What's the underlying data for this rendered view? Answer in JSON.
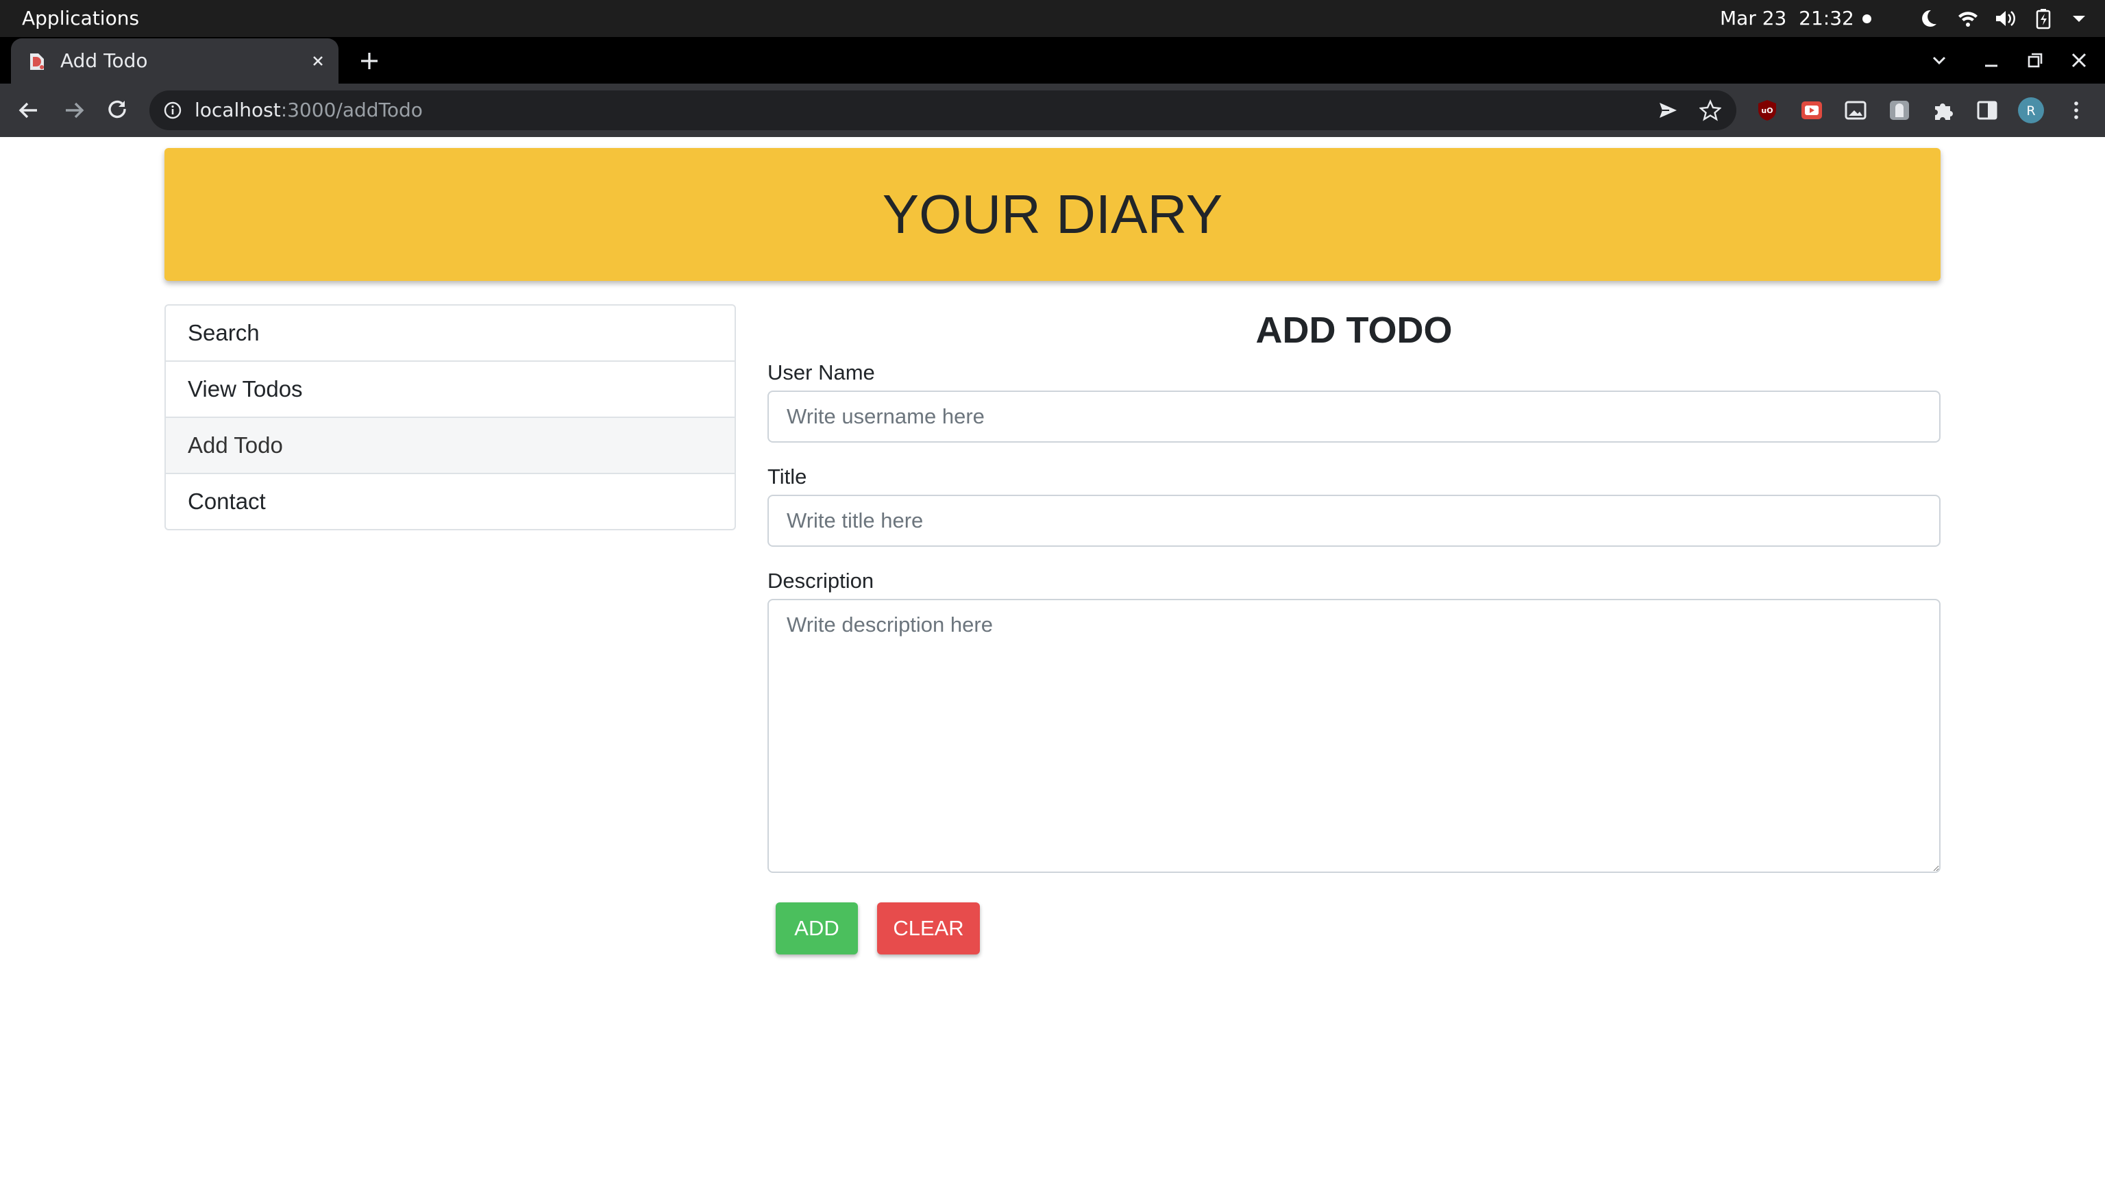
{
  "system_bar": {
    "applications_label": "Applications",
    "date": "Mar 23",
    "time": "21:32",
    "icons": [
      "night-light-icon",
      "wifi-icon",
      "volume-icon",
      "battery-icon",
      "system-menu-chevron-icon"
    ]
  },
  "browser": {
    "tab": {
      "title": "Add Todo"
    },
    "address": {
      "host": "localhost",
      "path": ":3000/addTodo"
    },
    "avatar_letter": "R",
    "extension_icons": [
      "ublock-icon",
      "youtube-ext-icon",
      "picture-in-picture-icon",
      "dark-reader-icon",
      "extensions-puzzle-icon",
      "side-panel-icon"
    ]
  },
  "page": {
    "banner_title": "YOUR DIARY",
    "sidebar": {
      "items": [
        {
          "label": "Search"
        },
        {
          "label": "View Todos"
        },
        {
          "label": "Add Todo"
        },
        {
          "label": "Contact"
        }
      ],
      "active_item": "Add Todo"
    },
    "form": {
      "title": "ADD TODO",
      "username": {
        "label": "User Name",
        "value": "",
        "placeholder": "Write username here"
      },
      "title_field": {
        "label": "Title",
        "value": "",
        "placeholder": "Write title here"
      },
      "description": {
        "label": "Description",
        "value": "",
        "placeholder": "Write description here"
      },
      "add_label": "ADD",
      "clear_label": "CLEAR"
    }
  },
  "colors": {
    "banner": "#f5c33b",
    "add_button": "#4bbf5d",
    "clear_button": "#e74c4c",
    "avatar": "#4a8fa8"
  }
}
